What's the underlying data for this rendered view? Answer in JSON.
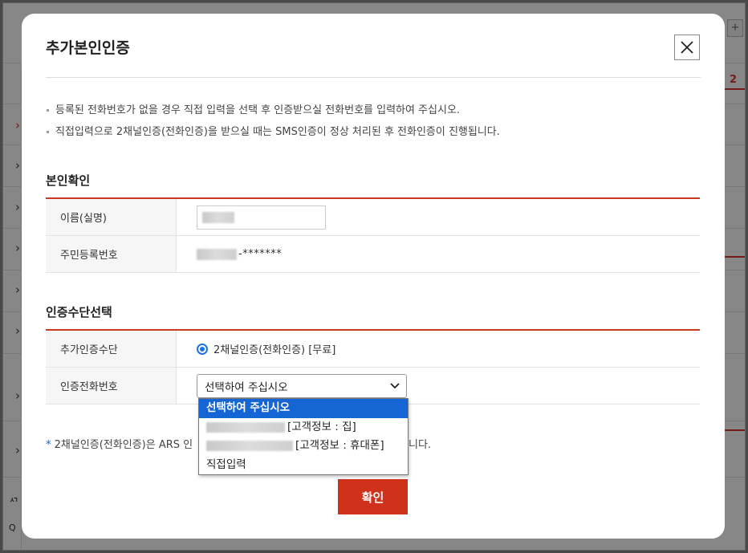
{
  "background": {
    "corner_number": "2",
    "plus_label": "+",
    "left_glyphs": [
      "ᄭ",
      "Q"
    ]
  },
  "modal": {
    "title": "추가본인인증",
    "close_icon": "close-icon",
    "notes": [
      "등록된 전화번호가 없을 경우 직접 입력을 선택 후 인증받으실 전화번호를 입력하여 주십시오.",
      "직접입력으로 2채널인증(전화인증)을 받으실 때는 SMS인증이 정상 처리된 후 전화인증이 진행됩니다."
    ],
    "identity_section": {
      "title": "본인확인",
      "name_label": "이름(실명)",
      "rrn_label": "주민등록번호",
      "rrn_mask": "-*******"
    },
    "auth_section": {
      "title": "인증수단선택",
      "method_label": "추가인증수단",
      "method_option": "2채널인증(전화인증) [무료]",
      "phone_label": "인증전화번호",
      "phone_select_value": "선택하여 주십시오",
      "phone_options": [
        "선택하여 주십시오",
        "[고객정보 : 집]",
        "[고객정보 : 휴대폰]",
        "직접입력"
      ]
    },
    "footnote_star": "*",
    "footnote_text": "2채널인증(전화인증)은 ARS 인",
    "footnote_tail": "니다.",
    "confirm_label": "확인"
  },
  "colors": {
    "accent_red": "#d0311b",
    "selection_blue": "#1566d4"
  }
}
